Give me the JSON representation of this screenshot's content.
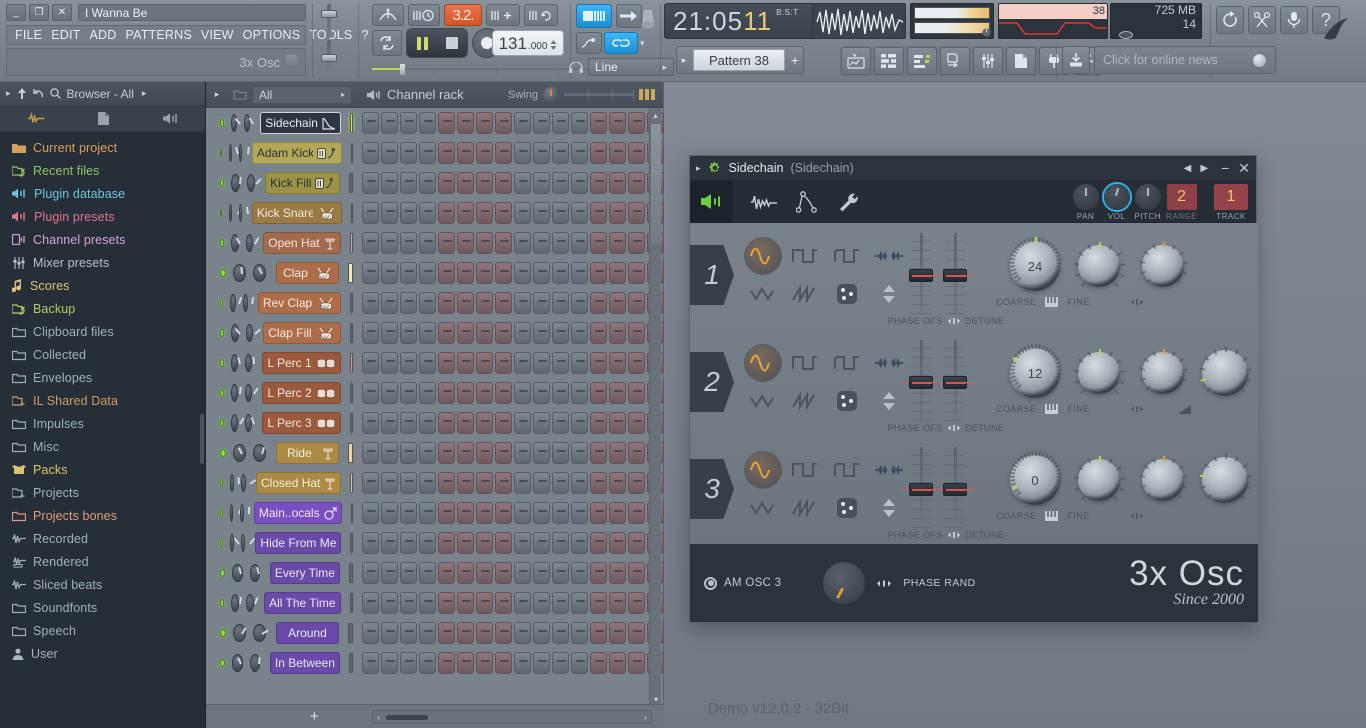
{
  "window": {
    "title": "I Wanna Be",
    "buttons": {
      "minimize": "_",
      "maximize": "❐",
      "close": "✕"
    },
    "menu": [
      "FILE",
      "EDIT",
      "ADD",
      "PATTERNS",
      "VIEW",
      "OPTIONS",
      "TOOLS",
      "?"
    ],
    "hint": "3x Osc"
  },
  "toolbar": {
    "tempo_int": "131",
    "tempo_frac": ".000",
    "time_display": "21:05",
    "time_seconds": "11",
    "time_format": "B:S:T",
    "cpu_percent": "38",
    "memory": "725 MB",
    "disk": "14",
    "pattern_label": "Pattern 38",
    "pattern_add": "+",
    "news_text": "Click for online news",
    "snap_label": "Line",
    "time_sig": "3.2.",
    "right_icons": [
      "undo-history-icon",
      "cut-tool-icon",
      "microphone-icon",
      "help-icon"
    ],
    "shortcut_icons": [
      "playlist-icon",
      "piano-roll-icon",
      "step-sequencer-icon",
      "browser-icon",
      "mixer-icon",
      "notes-icon",
      "plugin-picker-icon",
      "project-bones-icon"
    ]
  },
  "browser": {
    "header": "Browser - All",
    "tabs": [
      "waveform-tab",
      "file-tab",
      "plugin-tab"
    ],
    "items": [
      {
        "label": "Current project",
        "icon": "folder-open-icon",
        "color": "#d7a05a"
      },
      {
        "label": "Recent files",
        "icon": "folder-recent-icon",
        "color": "#8fc36a"
      },
      {
        "label": "Plugin database",
        "icon": "plugin-icon",
        "color": "#6fc3dd"
      },
      {
        "label": "Plugin presets",
        "icon": "plugin-preset-icon",
        "color": "#e0738f"
      },
      {
        "label": "Channel presets",
        "icon": "channel-preset-icon",
        "color": "#d3a3d8"
      },
      {
        "label": "Mixer presets",
        "icon": "mixer-preset-icon",
        "color": "#b9c2ca"
      },
      {
        "label": "Scores",
        "icon": "note-icon",
        "color": "#e0c07a"
      },
      {
        "label": "Backup",
        "icon": "folder-recent-icon",
        "color": "#b6c96a"
      },
      {
        "label": "Clipboard files",
        "icon": "folder-icon",
        "color": "#9fb0bd"
      },
      {
        "label": "Collected",
        "icon": "folder-icon",
        "color": "#9fb0bd"
      },
      {
        "label": "Envelopes",
        "icon": "folder-icon",
        "color": "#9fb0bd"
      },
      {
        "label": "IL Shared Data",
        "icon": "folder-link-icon",
        "color": "#cf9a6a"
      },
      {
        "label": "Impulses",
        "icon": "folder-icon",
        "color": "#9fb0bd"
      },
      {
        "label": "Misc",
        "icon": "folder-icon",
        "color": "#9fb0bd"
      },
      {
        "label": "Packs",
        "icon": "packs-icon",
        "color": "#d8c46a"
      },
      {
        "label": "Projects",
        "icon": "folder-link-icon",
        "color": "#9fb0bd"
      },
      {
        "label": "Projects bones",
        "icon": "folder-icon",
        "color": "#e09a7a"
      },
      {
        "label": "Recorded",
        "icon": "waveform-icon",
        "color": "#9fb0bd"
      },
      {
        "label": "Rendered",
        "icon": "rendered-icon",
        "color": "#9fb0bd"
      },
      {
        "label": "Sliced beats",
        "icon": "waveform-icon",
        "color": "#9fb0bd"
      },
      {
        "label": "Soundfonts",
        "icon": "folder-icon",
        "color": "#9fb0bd"
      },
      {
        "label": "Speech",
        "icon": "folder-icon",
        "color": "#9fb0bd"
      },
      {
        "label": "User",
        "icon": "user-icon",
        "color": "#aab6c2"
      }
    ]
  },
  "channel_rack": {
    "title": "Channel rack",
    "filter": "All",
    "swing_label": "Swing",
    "add_label": "+",
    "channels": [
      {
        "name": "Sidechain",
        "icon": "envelope-icon",
        "bg": "#2e3740",
        "text": "#e9eef2",
        "meter": "#d7e84a",
        "selected": true
      },
      {
        "name": "Adam Kick",
        "icon": "sampler-icon",
        "bg": "#b2a857",
        "text": "#2f3138",
        "meter": "#f2edb8"
      },
      {
        "name": "Kick Fill",
        "icon": "sampler-icon",
        "bg": "#9d9347",
        "text": "#2f3138",
        "meter": "#5d666e"
      },
      {
        "name": "Kick Snare",
        "icon": "drum-icon",
        "bg": "#9b7a45",
        "text": "#f0e9d8",
        "meter": "#5d666e"
      },
      {
        "name": "Open Hat",
        "icon": "hat-icon",
        "bg": "#a36a4e",
        "text": "#f3e6dd",
        "meter": "#d9a0bc"
      },
      {
        "name": "Clap",
        "icon": "drum-icon",
        "bg": "#ad6d4b",
        "text": "#f6eae1",
        "meter": "#f4e7b4"
      },
      {
        "name": "Rev Clap",
        "icon": "drum-icon",
        "bg": "#ad6d4b",
        "text": "#f6eae1",
        "meter": "#5d666e"
      },
      {
        "name": "Clap Fill",
        "icon": "drum-icon",
        "bg": "#ad6d4b",
        "text": "#f6eae1",
        "meter": "#5d666e"
      },
      {
        "name": "L Perc 1",
        "icon": "bongo-icon",
        "bg": "#9b5a3d",
        "text": "#f6e7de",
        "meter": "#e8916a"
      },
      {
        "name": "L Perc 2",
        "icon": "bongo-icon",
        "bg": "#9b5a3d",
        "text": "#f6e7de",
        "meter": "#5d666e"
      },
      {
        "name": "L Perc 3",
        "icon": "bongo-icon",
        "bg": "#9b5a3d",
        "text": "#f6e7de",
        "meter": "#5d666e"
      },
      {
        "name": "Ride",
        "icon": "hat-icon",
        "bg": "#ab8a45",
        "text": "#f6efdd",
        "meter": "#f3d2a0"
      },
      {
        "name": "Closed Hat",
        "icon": "hat-icon",
        "bg": "#ab8a45",
        "text": "#f6efdd",
        "meter": "#e9c894"
      },
      {
        "name": "Main..ocals",
        "icon": "male-icon",
        "bg": "#7a4fc0",
        "text": "#f0e9fb",
        "meter": "#9b76ef"
      },
      {
        "name": "Hide From Me",
        "icon": "",
        "bg": "#6a4aa8",
        "text": "#ece6f8",
        "meter": "#5d666e"
      },
      {
        "name": "Every Time",
        "icon": "",
        "bg": "#6a4aa8",
        "text": "#ece6f8",
        "meter": "#5d666e"
      },
      {
        "name": "All The Time",
        "icon": "",
        "bg": "#6a4aa8",
        "text": "#ece6f8",
        "meter": "#5d666e"
      },
      {
        "name": "Around",
        "icon": "",
        "bg": "#6a4aa8",
        "text": "#ece6f8",
        "meter": "#5d666e"
      },
      {
        "name": "In Between",
        "icon": "",
        "bg": "#6a4aa8",
        "text": "#ece6f8",
        "meter": "#5d666e"
      }
    ],
    "step_count": 16
  },
  "plugin": {
    "title": "Sidechain",
    "subtitle": "(Sidechain)",
    "header_icons": [
      "speaker-icon",
      "waveform-icon",
      "envelope-editor-icon",
      "wrench-icon"
    ],
    "pan_label": "PAN",
    "vol_label": "VOL",
    "pitch_label": "PITCH",
    "range_label": "RANGE",
    "range_value": "2",
    "track_label": "TRACK",
    "track_value": "1",
    "oscillators": [
      {
        "number": "1",
        "coarse": "24",
        "phase_label": "PHASE OFS",
        "detune_label": "DETUNE",
        "coarse_label": "COARSE",
        "fine_label": "FINE"
      },
      {
        "number": "2",
        "coarse": "12",
        "phase_label": "PHASE OFS",
        "detune_label": "DETUNE",
        "coarse_label": "COARSE",
        "fine_label": "FINE"
      },
      {
        "number": "3",
        "coarse": "0",
        "phase_label": "PHASE OFS",
        "detune_label": "DETUNE",
        "coarse_label": "COARSE",
        "fine_label": "FINE"
      }
    ],
    "am_label": "AM OSC 3",
    "phase_rand_label": "PHASE RAND",
    "brand": "3x Osc",
    "brand_sub": "Since 2000"
  },
  "status": {
    "demo": "Demo v12.0.2 - 32Bit"
  }
}
